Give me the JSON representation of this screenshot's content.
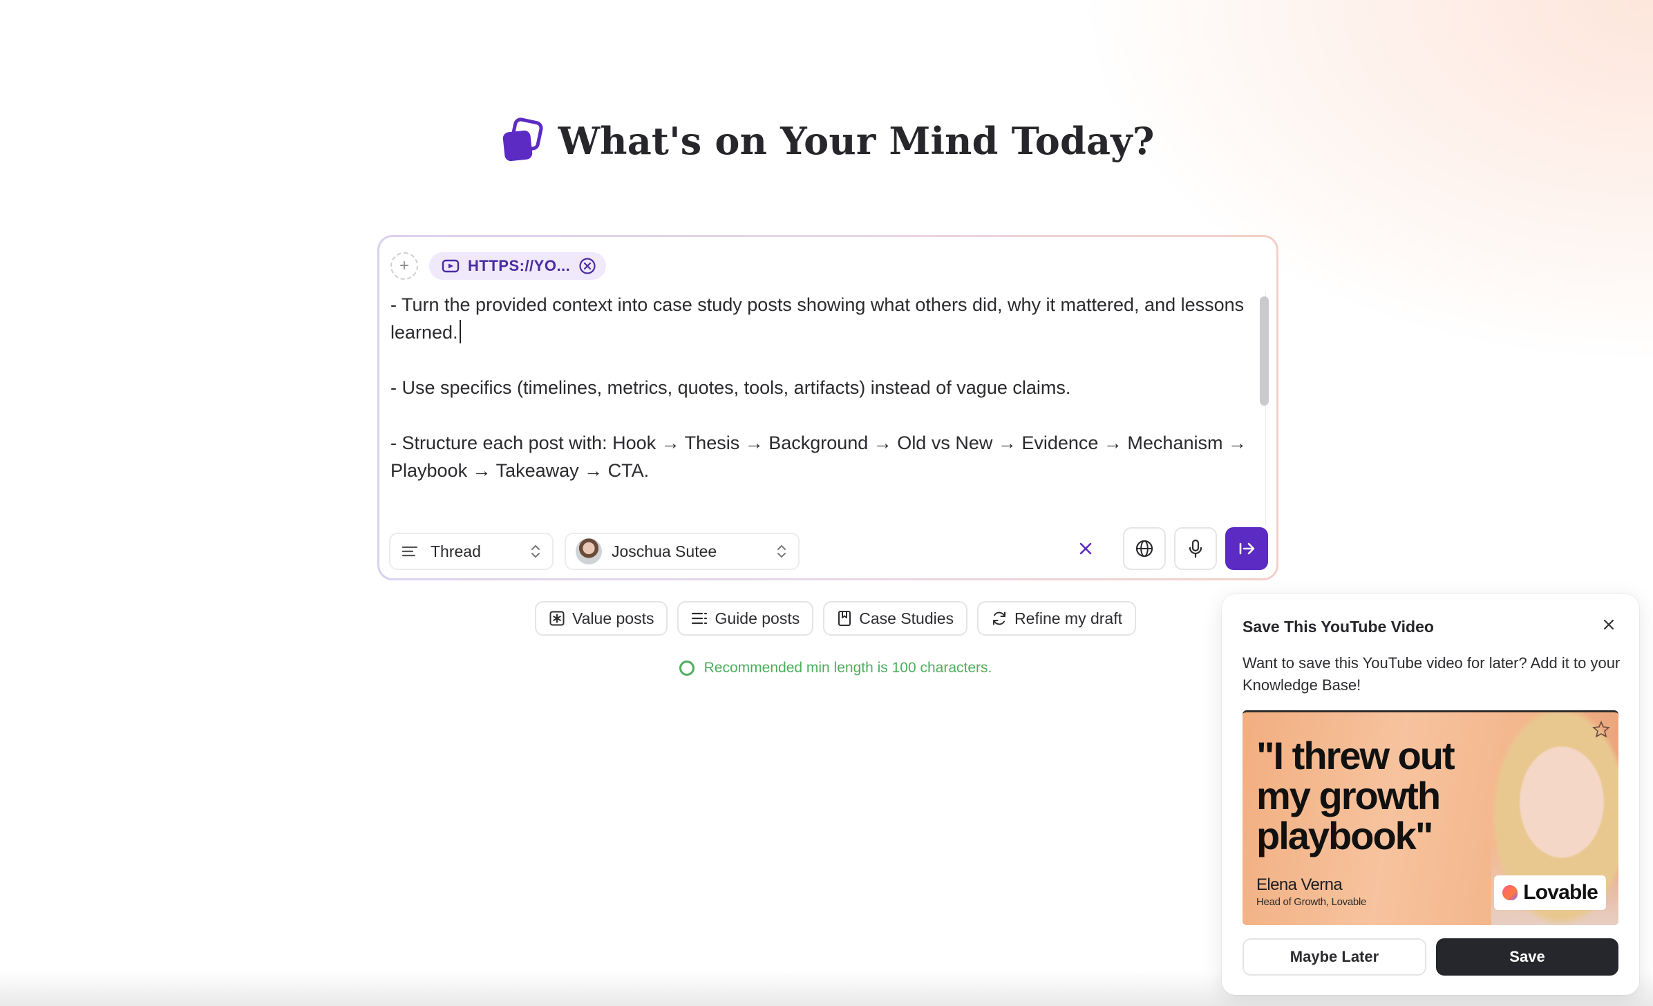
{
  "header": {
    "title": "What's on Your Mind Today?",
    "logo_icon": "stacked-squares-logo"
  },
  "composer": {
    "attachment": {
      "label": "HTTPS://YO...",
      "icon": "video-icon"
    },
    "content": {
      "paragraphs": [
        "- Turn the provided context into case study posts showing what others did, why it mattered, and lessons learned.",
        "- Use specifics (timelines, metrics, quotes, tools, artifacts) instead of vague claims.",
        "- Structure each post with: Hook → Thesis → Background → Old vs New → Evidence → Mechanism → Playbook → Takeaway → CTA."
      ]
    },
    "post_type": "Thread",
    "author": "Joschua Sutee",
    "colors": {
      "send_button": "#5b2bc4",
      "clear_icon": "#5b2bc4"
    }
  },
  "quick_actions": [
    {
      "label": "Value posts",
      "icon": "sparkle-box-icon"
    },
    {
      "label": "Guide posts",
      "icon": "list-icon"
    },
    {
      "label": "Case Studies",
      "icon": "bookmark-icon"
    },
    {
      "label": "Refine my draft",
      "icon": "refresh-icon"
    }
  ],
  "hint": {
    "text": "Recommended min length is 100 characters.",
    "color": "#4cae5c"
  },
  "save_popup": {
    "title": "Save This YouTube Video",
    "description": "Want to save this YouTube video for later? Add it to your Knowledge Base!",
    "thumbnail": {
      "quote_lines": [
        "\"I threw out",
        "my growth",
        "playbook\""
      ],
      "name": "Elena Verna",
      "role": "Head of Growth, Lovable",
      "brand": "Lovable"
    },
    "later_label": "Maybe Later",
    "save_label": "Save"
  }
}
